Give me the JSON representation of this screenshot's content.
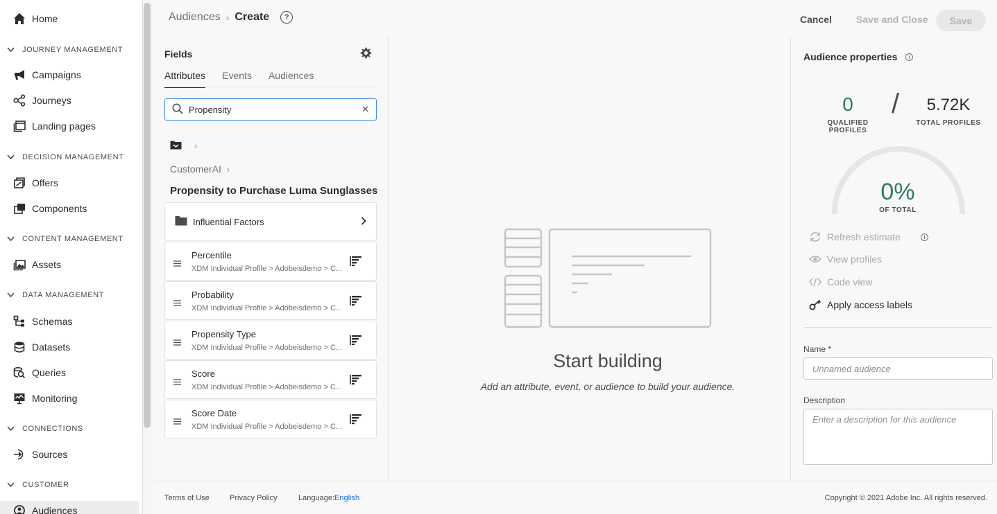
{
  "nav": {
    "home": "Home",
    "sections": [
      {
        "title": "JOURNEY MANAGEMENT",
        "items": [
          "Campaigns",
          "Journeys",
          "Landing pages"
        ]
      },
      {
        "title": "DECISION MANAGEMENT",
        "items": [
          "Offers",
          "Components"
        ]
      },
      {
        "title": "CONTENT MANAGEMENT",
        "items": [
          "Assets"
        ]
      },
      {
        "title": "DATA MANAGEMENT",
        "items": [
          "Schemas",
          "Datasets",
          "Queries",
          "Monitoring"
        ]
      },
      {
        "title": "CONNECTIONS",
        "items": [
          "Sources"
        ]
      },
      {
        "title": "CUSTOMER",
        "items": [
          "Audiences"
        ]
      }
    ]
  },
  "header": {
    "breadcrumb_parent": "Audiences",
    "breadcrumb_current": "Create",
    "help_icon": "?",
    "cancel": "Cancel",
    "save_and_close": "Save and Close",
    "save": "Save"
  },
  "fields": {
    "title": "Fields",
    "tabs": [
      "Attributes",
      "Events",
      "Audiences"
    ],
    "search_value": "Propensity",
    "path": "CustomerAI",
    "group_title": "Propensity to Purchase Luma Sunglasses",
    "folder_label": "Influential Factors",
    "items": [
      {
        "name": "Percentile",
        "path": "XDM Individual Profile > Adobeisdemo > C..."
      },
      {
        "name": "Probability",
        "path": "XDM Individual Profile > Adobeisdemo > C..."
      },
      {
        "name": "Propensity Type",
        "path": "XDM Individual Profile > Adobeisdemo > C..."
      },
      {
        "name": "Score",
        "path": "XDM Individual Profile > Adobeisdemo > C..."
      },
      {
        "name": "Score Date",
        "path": "XDM Individual Profile > Adobeisdemo > C..."
      }
    ]
  },
  "canvas": {
    "title": "Start building",
    "subtitle": "Add an attribute, event, or audience to build your audience."
  },
  "properties": {
    "title": "Audience properties",
    "qualified_value": "0",
    "qualified_label": "QUALIFIED PROFILES",
    "slash": "/",
    "total_value": "5.72K",
    "total_label": "TOTAL PROFILES",
    "percent": "0%",
    "percent_label": "OF TOTAL",
    "percent_fraction": 0,
    "refresh": "Refresh estimate",
    "view_profiles": "View profiles",
    "code_view": "Code view",
    "apply_labels": "Apply access labels",
    "name_label": "Name *",
    "name_placeholder": "Unnamed audience",
    "description_label": "Description",
    "description_placeholder": "Enter a description for this audience"
  },
  "footer": {
    "terms": "Terms of Use",
    "privacy": "Privacy Policy",
    "language_label": "Language:",
    "language_value": "English",
    "copyright": "Copyright © 2021 Adobe Inc. All rights reserved."
  },
  "colors": {
    "accent_green": "#2d7d5a",
    "link_blue": "#1473e6",
    "focus_blue": "#378ef0"
  }
}
